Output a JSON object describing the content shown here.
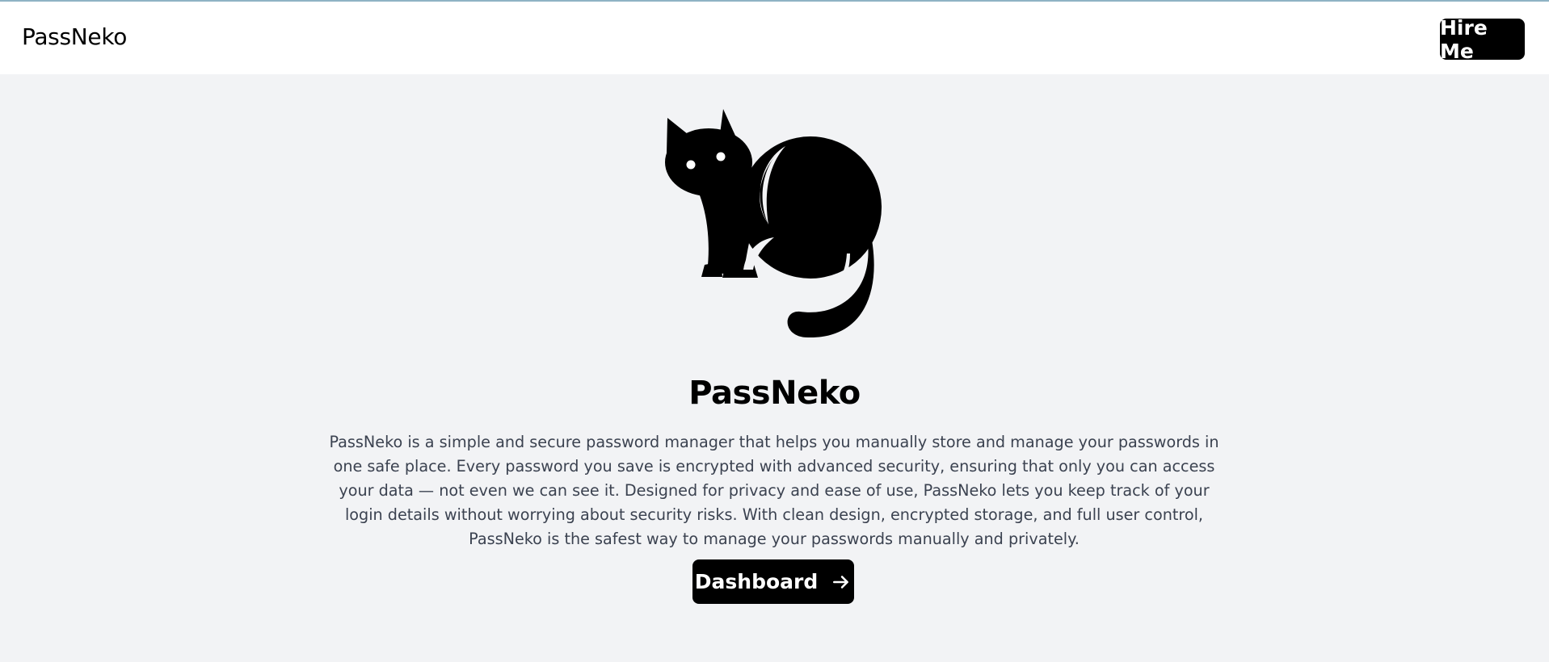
{
  "navbar": {
    "brand": "PassNeko",
    "hire_label": "Hire Me"
  },
  "hero": {
    "logo_icon": "cat-icon",
    "title": "PassNeko",
    "description": "PassNeko is a simple and secure password manager that helps you manually store and manage your passwords in one safe place. Every password you save is encrypted with advanced security, ensuring that only you can access your data — not even we can see it. Designed for privacy and ease of use, PassNeko lets you keep track of your login details without worrying about security risks. With clean design, encrypted storage, and full user control, PassNeko is the safest way to manage your passwords manually and privately.",
    "dashboard_label": "Dashboard",
    "dashboard_icon": "arrow-right-icon"
  },
  "colors": {
    "page_background": "#f2f3f5",
    "navbar_background": "#ffffff",
    "button_background": "#000000",
    "button_text": "#ffffff",
    "body_text": "#3b4250"
  }
}
